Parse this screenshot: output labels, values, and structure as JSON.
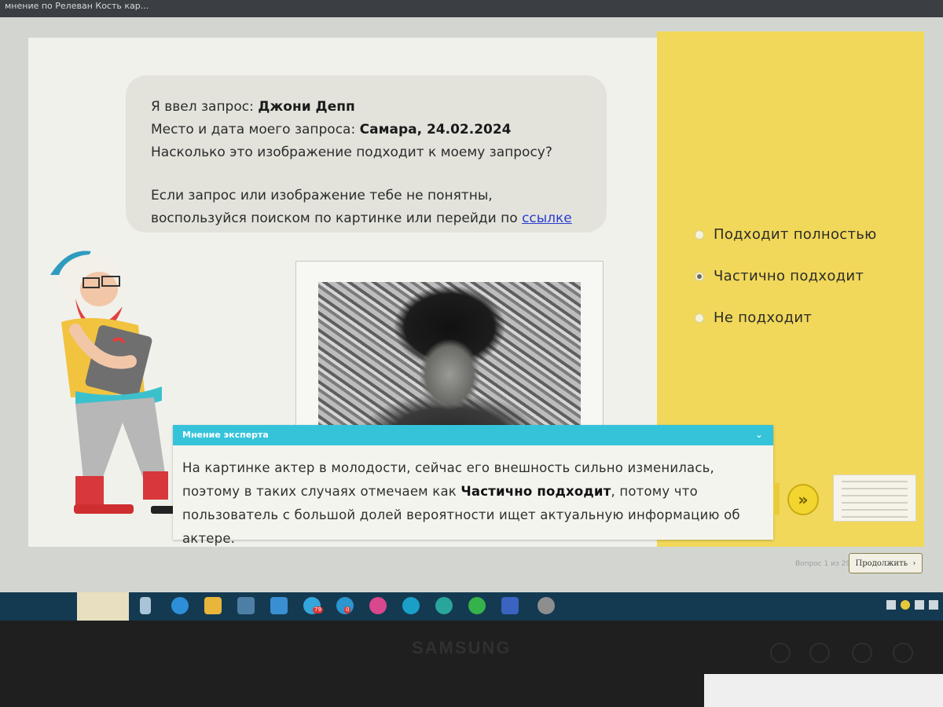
{
  "browser": {
    "tab_title": "мнение по Релеван Кость кар..."
  },
  "prompt": {
    "query_label": "Я ввел запрос:",
    "query_value": "Джони Депп",
    "place_label": "Место и дата моего запроса:",
    "place_value": "Самара, 24.02.2024",
    "question": "Насколько это изображение подходит к моему запросу?",
    "help_text": "Если запрос или изображение тебе не понятны, воспользуйся поиском по картинке или перейди по",
    "help_link": "ссылке"
  },
  "options": [
    {
      "label": "Подходит полностью",
      "selected": false
    },
    {
      "label": "Частично подходит",
      "selected": true
    },
    {
      "label": "Не подходит",
      "selected": false
    }
  ],
  "expert": {
    "title": "Мнение эксперта",
    "text_before": "На картинке актер в молодости, сейчас его внешность сильно изменилась, поэтому в таких случаях отмечаем как",
    "text_bold": "Частично подходит",
    "text_after": ", потому что пользователь с большой долей вероятности ищет актуальную информацию об актере."
  },
  "navigation": {
    "counter": "Вопрос 1 из 29",
    "continue_label": "Продолжить",
    "continue_icon": "chevron-right-icon",
    "next_icon": "double-chevron-right-icon"
  },
  "taskbar": {
    "badges": {
      "telegram": "79",
      "opera": "0"
    }
  },
  "monitor": {
    "brand": "SAMSUNG"
  },
  "colors": {
    "accent_yellow": "#f1d85a",
    "expert_header": "#35c3da",
    "link": "#2a3ccf",
    "taskbar": "#143a52"
  }
}
